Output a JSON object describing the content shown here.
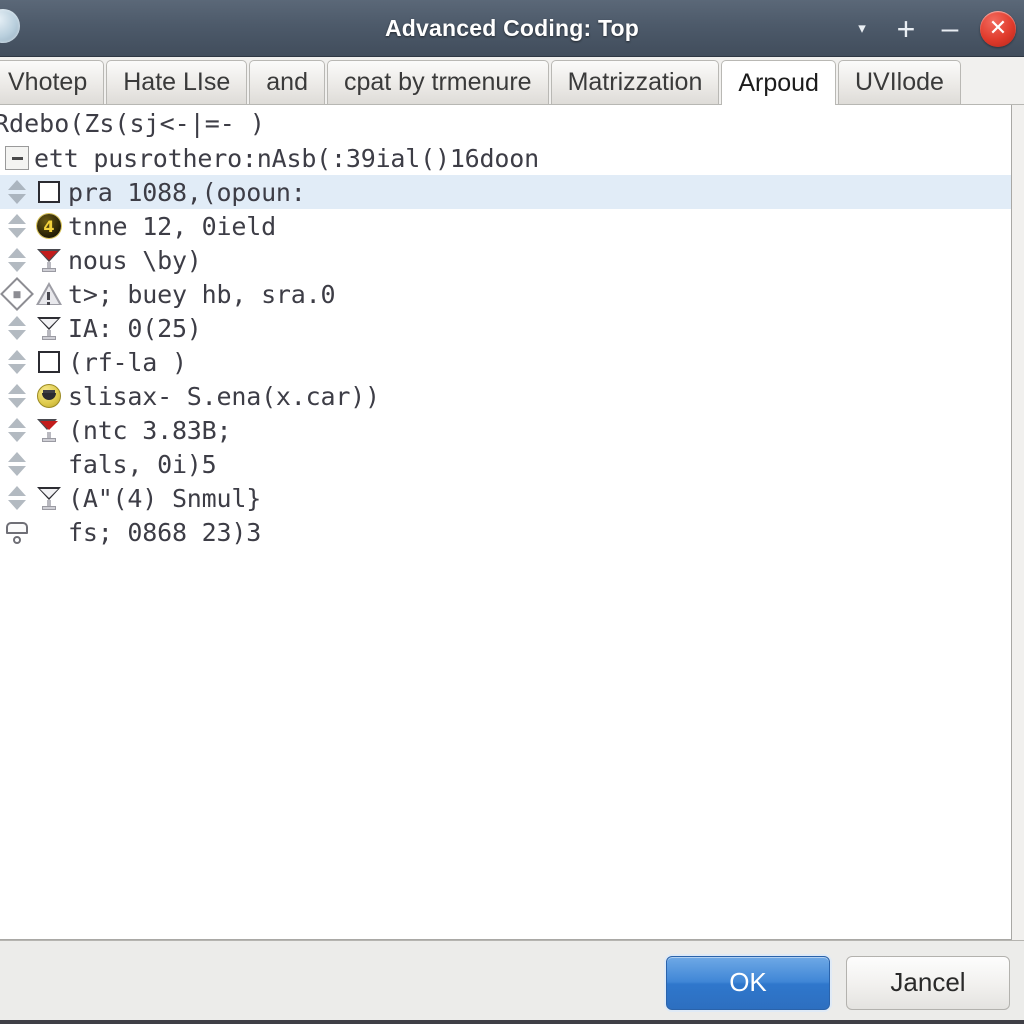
{
  "window": {
    "title": "Advanced Coding: Top",
    "app_icon": "orb-icon",
    "controls": [
      {
        "name": "dropdown-button",
        "glyph": "▾"
      },
      {
        "name": "maximize-button",
        "glyph": "+"
      },
      {
        "name": "minimize-button",
        "glyph": "–"
      },
      {
        "name": "close-button",
        "glyph": "✕"
      }
    ],
    "titlebar_color": "#4d5a6a",
    "close_color": "#e03b2c"
  },
  "tabs": [
    {
      "label": "Vhotep",
      "active": false
    },
    {
      "label": "Hate LIse",
      "active": false
    },
    {
      "label": "and",
      "active": false
    },
    {
      "label": "cpat by trmenure",
      "active": false
    },
    {
      "label": "Matrizzation",
      "active": false
    },
    {
      "label": "Arpoud",
      "active": true
    },
    {
      "label": "UVIlode",
      "active": false
    }
  ],
  "list": {
    "title_line": "Rdebo(Zs(sj<-|=- )",
    "rows": [
      {
        "gutter": "collapse-box-icon",
        "icon": null,
        "text": "ett pusrothero:nAsb(:39ial()16doon",
        "selected": false,
        "indent": true
      },
      {
        "gutter": "sort-arrows-icon",
        "icon": "checkbox-icon",
        "text": "pra 1088,(opoun:",
        "selected": true
      },
      {
        "gutter": "sort-arrows-icon",
        "icon": "badge-4-icon",
        "text": "tnne 12, 0ield",
        "selected": false
      },
      {
        "gutter": "sort-arrows-icon",
        "icon": "funnel-red-icon",
        "text": "nous \\by)",
        "selected": false
      },
      {
        "gutter": "diamond-icon",
        "icon": "warning-triangle-icon",
        "text": "t>; buey hb, sra.0",
        "selected": false
      },
      {
        "gutter": "sort-arrows-icon",
        "icon": "funnel-gray-icon",
        "text": "IA: 0(25)",
        "selected": false
      },
      {
        "gutter": "sort-arrows-icon",
        "icon": "checkbox-icon",
        "text": "(rf-la )",
        "selected": false
      },
      {
        "gutter": "sort-arrows-icon",
        "icon": "smiley-icon",
        "text": "slisax- S.ena(x.car))",
        "selected": false
      },
      {
        "gutter": "sort-arrows-icon",
        "icon": "funnel-small-icon",
        "text": "(ntc 3.83B;",
        "selected": false
      },
      {
        "gutter": "sort-arrows-icon",
        "icon": null,
        "text": "fals, 0i)5",
        "selected": false
      },
      {
        "gutter": "sort-arrows-icon",
        "icon": "funnel-dark-icon",
        "text": "(A\"(4) Snmul}",
        "selected": false
      },
      {
        "gutter": "stamp-icon",
        "icon": null,
        "text": "fs; 0868 23)3",
        "selected": false
      }
    ],
    "selected_row_color": "#e1ecf7",
    "accent_purple": "#7b5ea8",
    "accent_magenta": "#c0357a"
  },
  "footer": {
    "ok_label": "OK",
    "cancel_label": "Jancel",
    "ok_color": "#2f77cc"
  }
}
